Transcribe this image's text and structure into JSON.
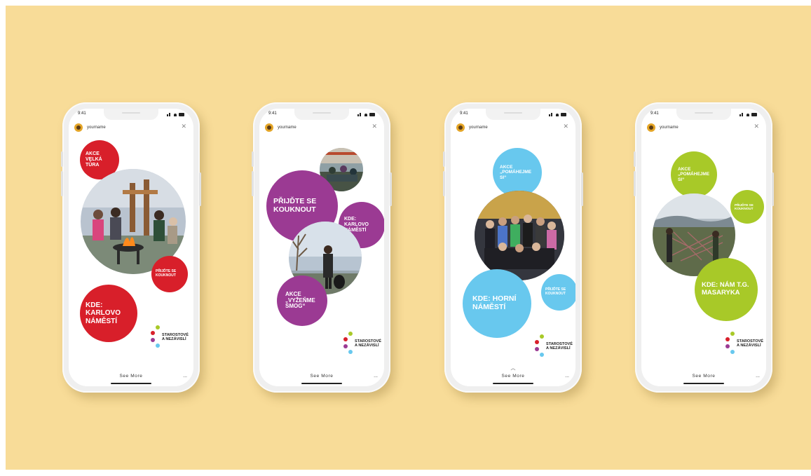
{
  "colors": {
    "background": "#f8dc98",
    "red": "#d81f2a",
    "purple": "#9b3a93",
    "blue": "#68c8ee",
    "green": "#a8c928"
  },
  "status_time": "9:41",
  "username": "yourname",
  "close_icon": "close-icon",
  "see_more": "See More",
  "more_dots": "...",
  "logo": {
    "line1": "STAROSTOVÉ",
    "line2": "A NEZÁVISLÍ"
  },
  "screens": [
    {
      "circles": [
        "AKCE VELKÁ TŮRA",
        "PŘIJĎTE SE KOUKNOUT",
        "KDE: KARLOVO NÁMĚSTÍ"
      ]
    },
    {
      "circles": [
        "PŘIJĎTE SE KOUKNOUT",
        "KDE: KARLOVO NÁMĚSTÍ",
        "AKCE „VYŽEŇME SMOG“"
      ]
    },
    {
      "circles": [
        "AKCE „POMÁHEJME SI“",
        "KDE: HORNÍ NÁMĚSTÍ",
        "PŘIJĎTE SE KOUKNOUT"
      ]
    },
    {
      "circles": [
        "AKCE „POMÁHEJME SI“",
        "PŘIJĎTE SE KOUKNOUT",
        "KDE: NÁM T.G. MASARYKA"
      ]
    }
  ]
}
